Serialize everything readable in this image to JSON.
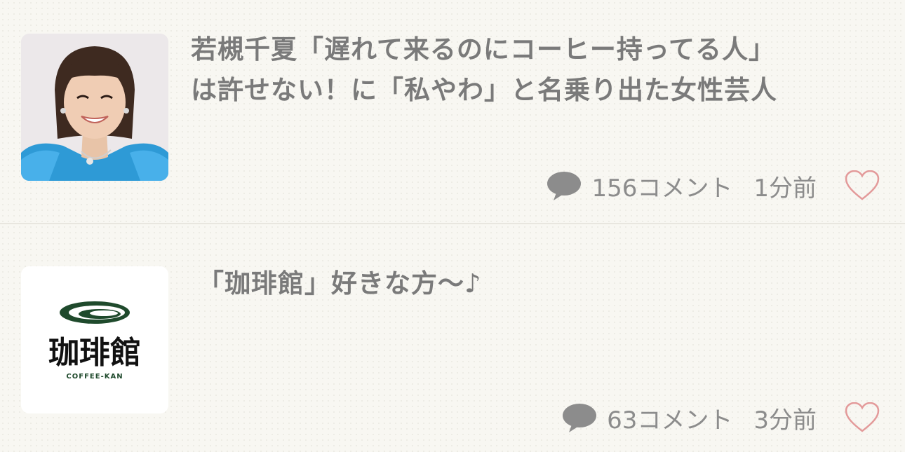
{
  "articles": [
    {
      "title_line1": "若槻千夏「遅れて来るのにコーヒー持ってる人」",
      "title_line2": "は許せない！に「私やわ」と名乗り出た女性芸人",
      "comment_count": "156コメント",
      "time_ago": "1分前",
      "thumbnail_icon": "person-photo",
      "like_icon": "heart-outline-icon"
    },
    {
      "title": "「珈琲館」好きな方〜♪",
      "comment_count": "63コメント",
      "time_ago": "3分前",
      "thumbnail_logo_text": "珈琲館",
      "thumbnail_logo_subtext": "COFFEE-KAN",
      "like_icon": "heart-outline-icon"
    }
  ],
  "colors": {
    "background": "#f8f7f2",
    "title_text": "#7a7a7a",
    "meta_text": "#8c8c8c",
    "heart": "#e39a9a",
    "logo_green": "#1f4a2c",
    "dress_blue": "#2e9ad6"
  }
}
